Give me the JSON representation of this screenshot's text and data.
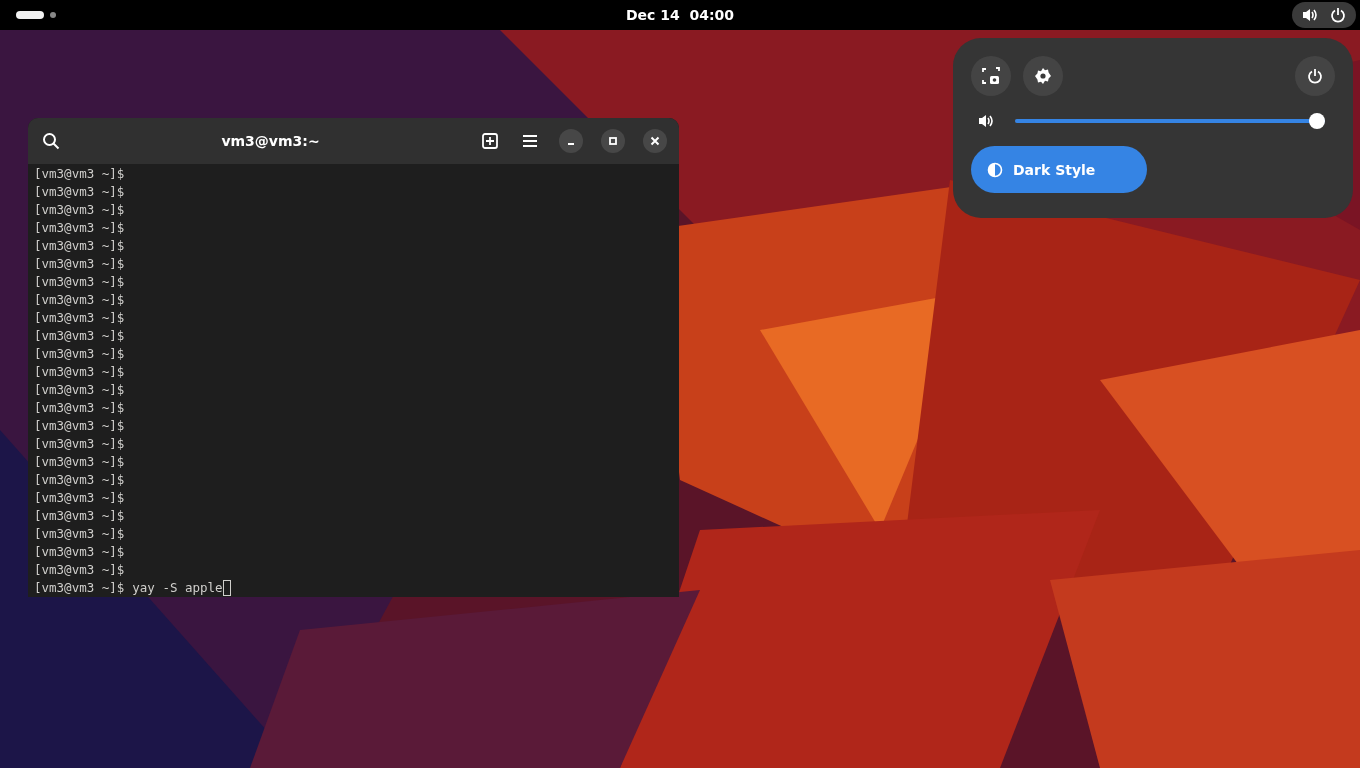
{
  "top_bar": {
    "clock": "Dec 14  04:00"
  },
  "terminal": {
    "title": "vm3@vm3:~",
    "lines": [
      {
        "prompt": "[vm3@vm3 ~]$"
      },
      {
        "prompt": "[vm3@vm3 ~]$"
      },
      {
        "prompt": "[vm3@vm3 ~]$"
      },
      {
        "prompt": "[vm3@vm3 ~]$"
      },
      {
        "prompt": "[vm3@vm3 ~]$"
      },
      {
        "prompt": "[vm3@vm3 ~]$"
      },
      {
        "prompt": "[vm3@vm3 ~]$"
      },
      {
        "prompt": "[vm3@vm3 ~]$"
      },
      {
        "prompt": "[vm3@vm3 ~]$"
      },
      {
        "prompt": "[vm3@vm3 ~]$"
      },
      {
        "prompt": "[vm3@vm3 ~]$"
      },
      {
        "prompt": "[vm3@vm3 ~]$"
      },
      {
        "prompt": "[vm3@vm3 ~]$"
      },
      {
        "prompt": "[vm3@vm3 ~]$"
      },
      {
        "prompt": "[vm3@vm3 ~]$"
      },
      {
        "prompt": "[vm3@vm3 ~]$"
      },
      {
        "prompt": "[vm3@vm3 ~]$"
      },
      {
        "prompt": "[vm3@vm3 ~]$"
      },
      {
        "prompt": "[vm3@vm3 ~]$"
      },
      {
        "prompt": "[vm3@vm3 ~]$"
      },
      {
        "prompt": "[vm3@vm3 ~]$"
      },
      {
        "prompt": "[vm3@vm3 ~]$"
      },
      {
        "prompt": "[vm3@vm3 ~]$"
      },
      {
        "prompt": "[vm3@vm3 ~]$",
        "command": "yay -S apple"
      }
    ]
  },
  "quick_settings": {
    "volume": {
      "level": 1.0
    },
    "toggles": [
      {
        "label": "Dark Style",
        "on": true
      }
    ]
  }
}
